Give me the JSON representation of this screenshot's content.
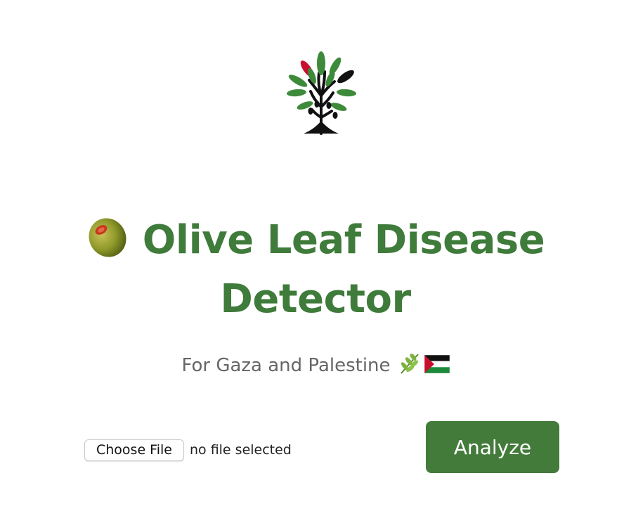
{
  "header": {
    "logo_icon": "olive-tree-logo-icon",
    "title_icon": "olive-icon",
    "title_line1": "Olive Leaf Disease",
    "title_line2": "Detector",
    "subtitle": "For Gaza and Palestine",
    "subtitle_icons": [
      "herb-icon",
      "palestine-flag-icon"
    ]
  },
  "upload": {
    "choose_file_label": "Choose File",
    "file_status": "no file selected",
    "analyze_label": "Analyze"
  },
  "colors": {
    "primary_green": "#437b3b",
    "title_green": "#3f7b3a",
    "subtitle_gray": "#666666",
    "flag_red": "#c8102e"
  }
}
